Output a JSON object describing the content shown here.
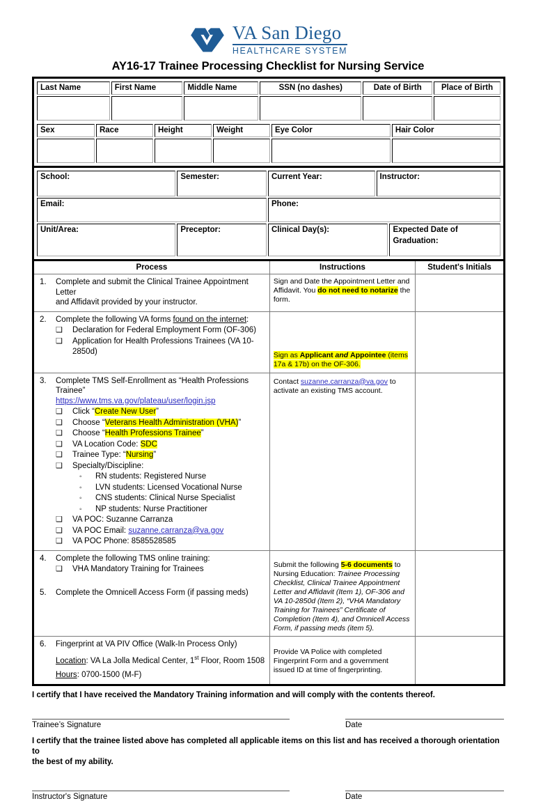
{
  "logo": {
    "mark_name": "va-logo-mark",
    "title": "VA San Diego",
    "subtitle": "HEALTHCARE SYSTEM",
    "color": "#1f5c96"
  },
  "doc_title": "AY16-17 Trainee Processing Checklist for Nursing Service",
  "identity": {
    "row1": [
      {
        "label": "Last Name"
      },
      {
        "label": "First Name"
      },
      {
        "label": "Middle Name"
      },
      {
        "label": "SSN (no dashes)"
      },
      {
        "label": "Date of Birth"
      },
      {
        "label": "Place of Birth"
      }
    ],
    "row2": [
      {
        "label": "Sex"
      },
      {
        "label": "Race"
      },
      {
        "label": "Height"
      },
      {
        "label": "Weight"
      },
      {
        "label": "Eye Color"
      },
      {
        "label": "Hair Color"
      }
    ]
  },
  "school": {
    "school": "School:",
    "semester": "Semester:",
    "current_year": "Current Year:",
    "instructor": "Instructor:",
    "email": "Email:",
    "phone": "Phone:",
    "unit_area": "Unit/Area:",
    "preceptor": "Preceptor:",
    "clinical_days": "Clinical Day(s):",
    "expected_grad_line1": "Expected Date of",
    "expected_grad_line2": "Graduation:"
  },
  "process_table": {
    "headers": {
      "process": "Process",
      "instructions": "Instructions",
      "initials": "Student's Initials"
    },
    "items": {
      "i1": {
        "num": "1.",
        "text_line1": "Complete and submit the Clinical Trainee Appointment Letter",
        "text_line2": "and Affidavit provided by your instructor."
      },
      "i2": {
        "num": "2.",
        "lead_pre": "Complete the following VA forms ",
        "lead_u": "found on the internet",
        "lead_post": ":",
        "sub": [
          "Declaration for Federal Employment Form (OF-306)",
          "Application for Health Professions Trainees (VA 10-2850d)"
        ]
      },
      "i3": {
        "num": "3.",
        "lead_line1": "Complete TMS Self-Enrollment as “Health Professions",
        "lead_line2": "Trainee”",
        "url": "https://www.tms.va.gov/plateau/user/login.jsp",
        "sub": [
          {
            "pre": "Click “",
            "hl": "Create New User",
            "post": "”"
          },
          {
            "pre": "Choose “",
            "hl": "Veterans Health Administration (VHA)",
            "post": "”"
          },
          {
            "pre": "Choose “",
            "hl": "Health Professions Trainee",
            "post": "”"
          },
          {
            "pre": "VA Location Code: ",
            "hl": "SDC",
            "post": ""
          },
          {
            "pre": "Trainee Type: “",
            "hl": "Nursing",
            "post": "”"
          },
          {
            "pre": "Specialty/Discipline:",
            "hl": "",
            "post": ""
          }
        ],
        "specialties": [
          "RN students: Registered Nurse",
          "LVN students: Licensed Vocational Nurse",
          "CNS students: Clinical Nurse Specialist",
          "NP students: Nurse Practitioner"
        ],
        "poc_name": "VA POC: Suzanne Carranza",
        "poc_email_pre": "VA POC Email: ",
        "poc_email": "suzanne.carranza@va.gov",
        "poc_phone": "VA POC Phone: 8585528585"
      },
      "i4": {
        "num": "4.",
        "lead": "Complete the following TMS online training:",
        "sub": [
          "VHA Mandatory Training for Trainees"
        ]
      },
      "i5": {
        "num": "5.",
        "lead": "Complete the Omnicell Access Form (if passing meds)"
      },
      "i6": {
        "num": "6.",
        "lead": "Fingerprint at VA PIV Office (Walk-In Process Only)",
        "location_label": "Location",
        "location_value": ": VA La Jolla Medical Center, 1",
        "location_sup": "st",
        "location_rest": " Floor, Room 1508",
        "hours_label": "Hours",
        "hours_value": ": 0700-1500 (M-F)"
      }
    },
    "instructions": {
      "r1": {
        "pre": "Sign and Date the Appointment Letter and Affidavit. You ",
        "hl": "do not need to notarize",
        "post": " the form."
      },
      "r2": {
        "hl_pre": "Sign as ",
        "hl_b1": "Applicant",
        "hl_i": " and ",
        "hl_b2": "Appointee",
        "hl_post": " (items 17a & 17b) on the OF-306."
      },
      "r3": {
        "pre": "Contact ",
        "link": "suzanne.carranza@va.gov",
        "post": " to activate an existing TMS account."
      },
      "r4": {
        "pre": "Submit the following ",
        "hl": "5-6 documents",
        "mid": " to Nursing Education: ",
        "italic": "Trainee Processing Checklist, Clinical Trainee Appointment Letter and Affidavit (Item 1), OF-306 and VA 10-2850d (Item 2), “VHA Mandatory Training for Trainees” Certificate of Completion (Item 4), and Omnicell Access Form, if passing meds (item 5)."
      },
      "r5": {
        "text": "Provide VA Police with completed Fingerprint Form and a government issued ID at time of fingerprinting."
      }
    }
  },
  "certifications": {
    "trainee_cert": "I certify that I have received the Mandatory Training information and will comply with the contents thereof.",
    "trainee_sig_label": "Trainee’s Signature",
    "trainee_date_label": "Date",
    "instructor_cert_line1": "I certify that the trainee listed above has completed all applicable items on this list and has received a thorough orientation to",
    "instructor_cert_line2": "the best of my ability.",
    "instructor_sig_label": "Instructor's Signature",
    "instructor_date_label": "Date"
  }
}
